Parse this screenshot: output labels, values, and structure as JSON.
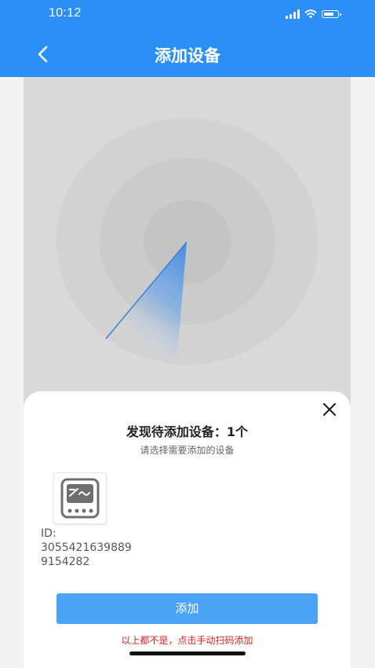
{
  "status_bar": {
    "time": "10:12"
  },
  "header": {
    "title": "添加设备"
  },
  "sheet": {
    "title": "发现待添加设备：1个",
    "subtitle": "请选择需要添加的设备",
    "device": {
      "id_label": "ID:",
      "id_value": "30554216398899154282"
    },
    "add_button_label": "添加",
    "manual_link": "以上都不是，点击手动扫码添加"
  },
  "colors": {
    "header": "#2a8ff7",
    "button": "#4aa3f6",
    "link": "#e02020"
  },
  "icons": {
    "back": "chevron-left-icon",
    "close": "close-icon",
    "device": "inverter-icon"
  }
}
